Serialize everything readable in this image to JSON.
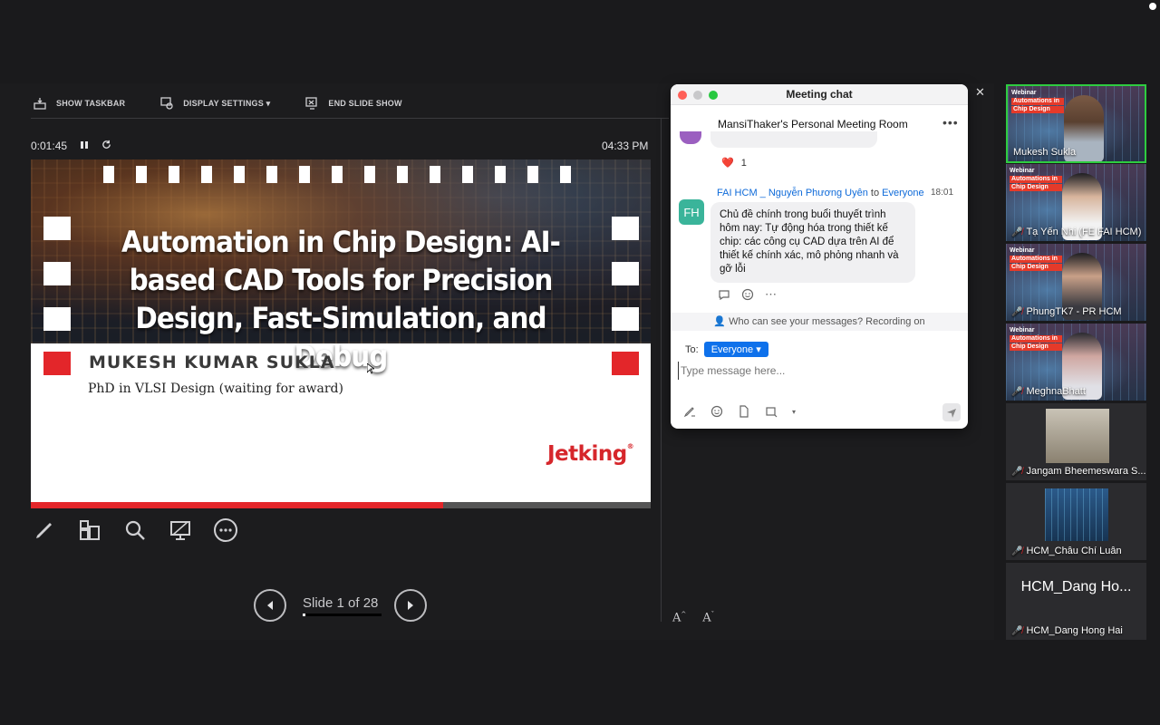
{
  "presenter": {
    "toolbar": {
      "show_taskbar": "SHOW TASKBAR",
      "display_settings": "DISPLAY SETTINGS ▾",
      "end_slide_show": "END SLIDE SHOW"
    },
    "elapsed_time": "0:01:45",
    "clock": "04:33 PM",
    "slide": {
      "title": "Automation in Chip Design: AI-based CAD Tools for Precision Design, Fast-Simulation, and Debug",
      "speaker": "MUKESH KUMAR SUKLA",
      "degree": "PhD in VLSI Design (waiting for award)",
      "logo": "Jetking",
      "progress_fraction": 0.665
    },
    "slide_counter": "Slide 1 of 28",
    "colors": {
      "accent_red": "#e3262a",
      "chat_blue": "#0e71eb"
    }
  },
  "chat": {
    "window_title": "Meeting chat",
    "room_name": "MansiThaker's Personal Meeting Room",
    "reaction_emoji": "❤️",
    "reaction_count": "1",
    "message": {
      "avatar_initials": "FH",
      "sender": "FAI HCM _ Nguyễn Phương Uyên",
      "to_word": "to",
      "recipient": "Everyone",
      "time": "18:01",
      "text": "Chủ đề chính trong buổi thuyết trình hôm nay: Tự động hóa trong thiết kế chip: các công cụ CAD dựa trên AI để thiết kế chính xác, mô phỏng nhanh và gỡ lỗi"
    },
    "visibility_notice": "Who can see your messages? Recording on",
    "to_label": "To:",
    "to_value": "Everyone",
    "compose_placeholder": "Type message here..."
  },
  "participants": [
    {
      "name": "Mukesh Sukla",
      "muted": false,
      "active": true
    },
    {
      "name": "Tạ Yến Nhi (FE FAI HCM)",
      "muted": true
    },
    {
      "name": "PhungTK7 - PR HCM",
      "muted": true
    },
    {
      "name": "MeghnaBhatt",
      "muted": true
    },
    {
      "name": "Jangam Bheemeswara S...",
      "muted": true
    },
    {
      "name": "HCM_Châu Chí Luân",
      "muted": true
    },
    {
      "name": "HCM_Dang Hong Hai",
      "muted": true,
      "display_text": "HCM_Dang Ho..."
    }
  ],
  "tile_banner": {
    "line1": "Webinar",
    "line2": "Automations in",
    "line3": "Chip Design"
  }
}
